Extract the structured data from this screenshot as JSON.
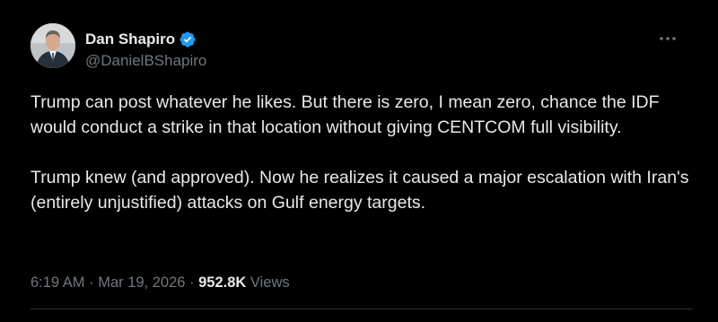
{
  "author": {
    "display_name": "Dan Shapiro",
    "handle": "@DanielBShapiro",
    "verified": true,
    "verified_icon": "verified-badge-icon",
    "verified_color": "#1d9bf0"
  },
  "menu": {
    "more_icon": "more-horizontal-icon"
  },
  "tweet": {
    "paragraphs": [
      "Trump can post whatever he likes. But there is zero, I mean zero, chance the IDF would conduct a strike in that location without giving CENTCOM full visibility.",
      "Trump knew (and approved). Now he realizes it caused a major escalation with Iran's (entirely unjustified) attacks on Gulf energy targets."
    ]
  },
  "meta": {
    "time": "6:19 AM",
    "separator": " · ",
    "date": "Mar 19, 2026",
    "views_count": "952.8K",
    "views_label": " Views"
  },
  "colors": {
    "background": "#000000",
    "primary_text": "#e7e9ea",
    "secondary_text": "#71767b",
    "divider": "#2f3336"
  }
}
